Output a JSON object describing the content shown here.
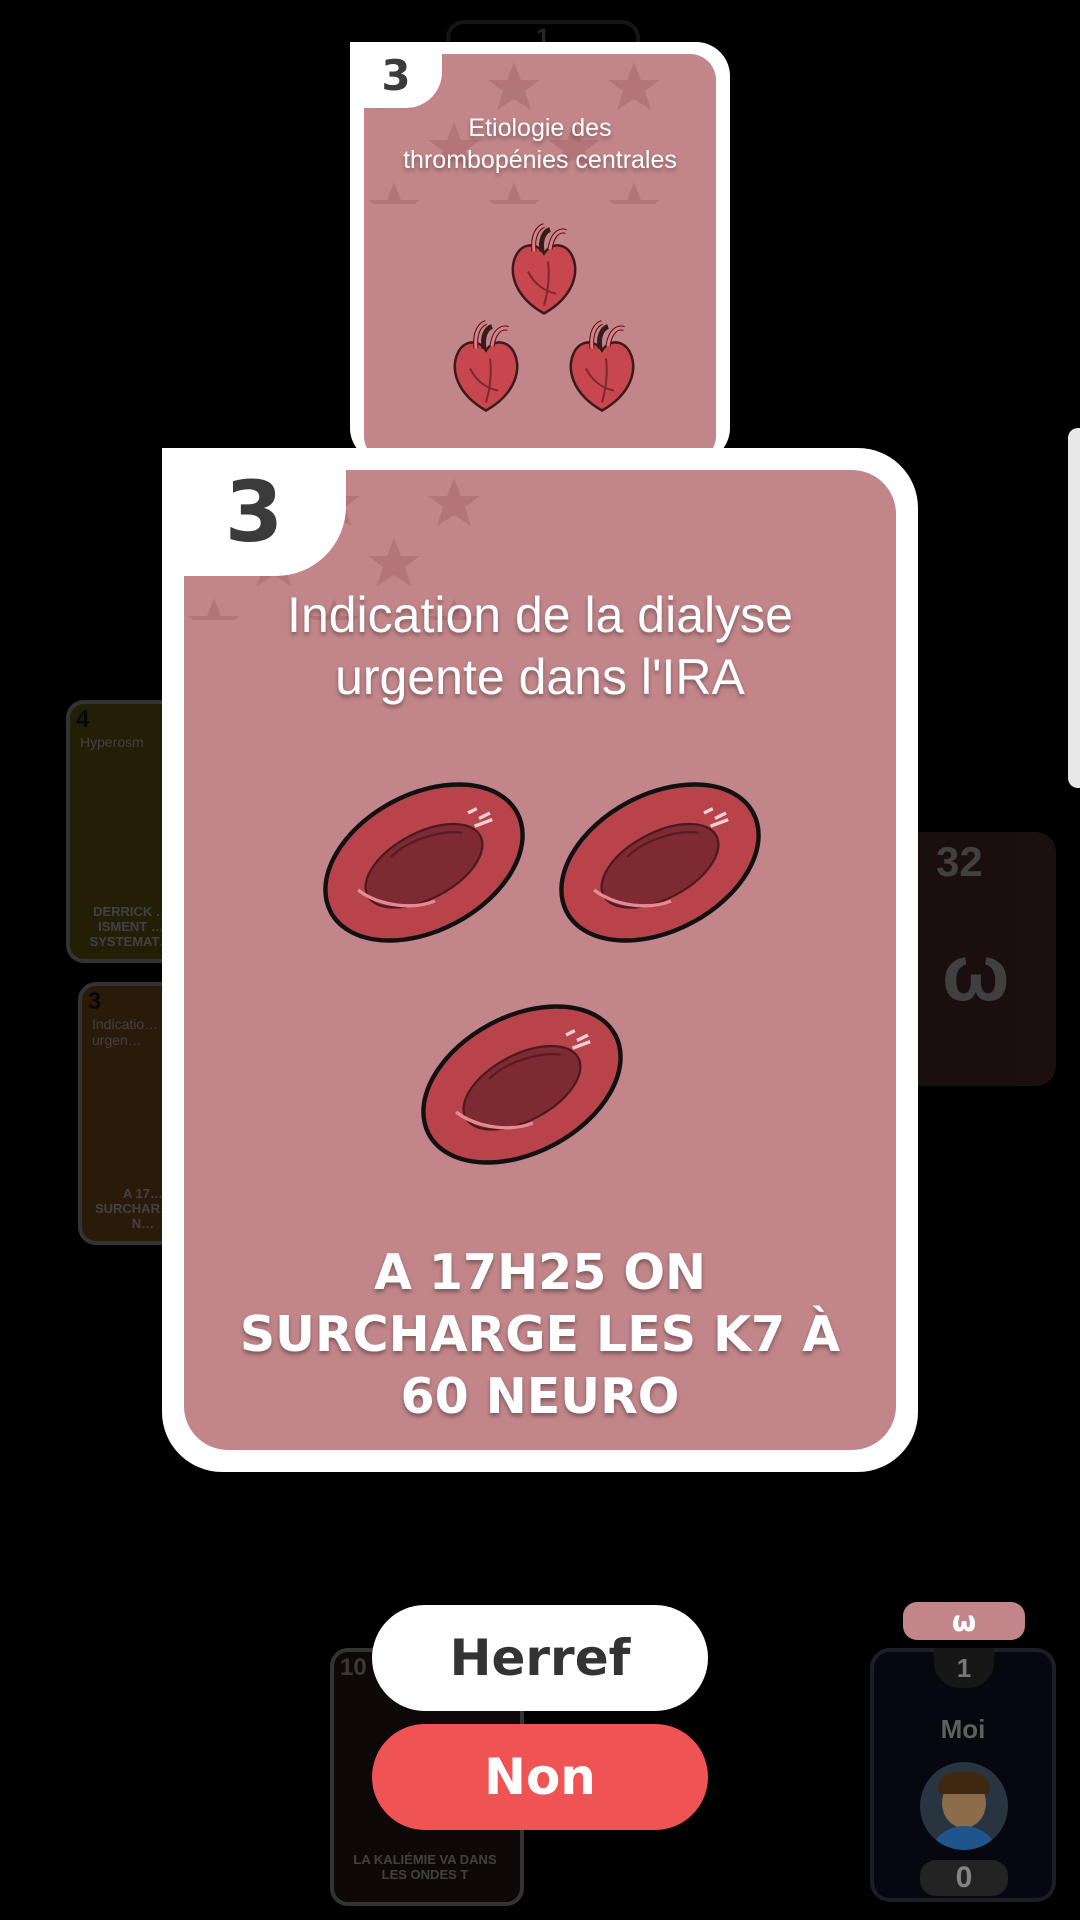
{
  "colors": {
    "card_face": "#c2868a",
    "star": "#a8676c",
    "accent_red": "#ef5353",
    "dark_card": "#3a2020",
    "yellow_card": "#8a7a1a"
  },
  "top_card": {
    "number": "3",
    "title_line1": "Etiologie des",
    "title_line2": "thrombopénies centrales",
    "image": "heart-icon"
  },
  "peek_card": {
    "number": "1"
  },
  "main_card": {
    "number": "3",
    "title_line1": "Indication de la dialyse",
    "title_line2": "urgente dans l'IRA",
    "image": "red-blood-cell-icon",
    "footer_line1": "A 17H25 ON",
    "footer_line2": "SURCHARGE LES K7 À",
    "footer_line3": "60 NEURO"
  },
  "left_cards": [
    {
      "number": "4",
      "title": "Hyperosm",
      "footer": "DERRICK … ISMENT … SYSTEMAT…"
    },
    {
      "number": "3",
      "title": "Indicatio… urgen…",
      "footer": "A 17… SURCHAR… 60 N…"
    }
  ],
  "right_card": {
    "number": "32"
  },
  "bottom_card": {
    "number": "10",
    "footer": "LA KALIÉMIE VA DANS LES ONDES T"
  },
  "player": {
    "tag_icon": "logo-icon",
    "rank": "1",
    "name": "Moi",
    "score": "0"
  },
  "buttons": {
    "herref": "Herref",
    "non": "Non"
  }
}
